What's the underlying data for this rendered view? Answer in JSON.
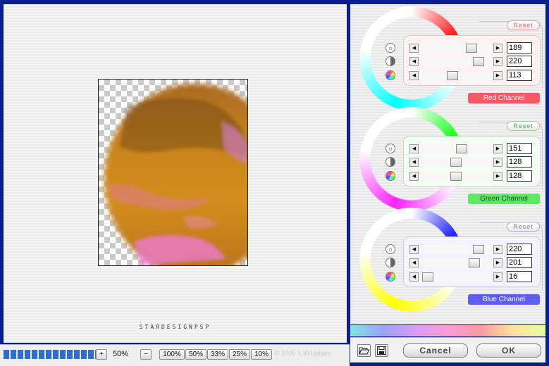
{
  "preview": {
    "credit": "STARDESIGNPSP"
  },
  "toolbar": {
    "progress_segments": 14,
    "plus_label": "+",
    "zoom_value": "50%",
    "minus_label": "−",
    "presets": [
      "100%",
      "50%",
      "33%",
      "25%",
      "10%"
    ],
    "copyright": "© 2005  S.W.Upham"
  },
  "channels": [
    {
      "name": "Red Channel",
      "reset_label": "Reset",
      "accent": "#f25a66",
      "label_text_color": "#ffffff",
      "reset_text_color": "#c86a6a",
      "reset_border": "#e0a0a0",
      "box_tint": "#fff2f2",
      "ring_colors": [
        "#ff2020",
        "#00ffff"
      ],
      "sliders": [
        {
          "icon": "sun-icon",
          "value": "189",
          "fraction": 0.74
        },
        {
          "icon": "contrast-icon",
          "value": "220",
          "fraction": 0.86
        },
        {
          "icon": "hue-icon",
          "value": "113",
          "fraction": 0.44
        }
      ]
    },
    {
      "name": "Green Channel",
      "reset_label": "Reset",
      "accent": "#56ec5e",
      "label_text_color": "#1e4a1e",
      "reset_text_color": "#5a9a5a",
      "reset_border": "#9ad49a",
      "box_tint": "#f2fff2",
      "ring_colors": [
        "#22ff22",
        "#ff22ff"
      ],
      "sliders": [
        {
          "icon": "sun-icon",
          "value": "151",
          "fraction": 0.59
        },
        {
          "icon": "contrast-icon",
          "value": "128",
          "fraction": 0.5
        },
        {
          "icon": "hue-icon",
          "value": "128",
          "fraction": 0.5
        }
      ]
    },
    {
      "name": "Blue Channel",
      "reset_label": "Reset",
      "accent": "#5d5df0",
      "label_text_color": "#ffffff",
      "reset_text_color": "#7a7ab0",
      "reset_border": "#a8a8d8",
      "box_tint": "#f4f4ff",
      "ring_colors": [
        "#2222ff",
        "#ffff00"
      ],
      "sliders": [
        {
          "icon": "sun-icon",
          "value": "220",
          "fraction": 0.86
        },
        {
          "icon": "contrast-icon",
          "value": "201",
          "fraction": 0.79
        },
        {
          "icon": "hue-icon",
          "value": "16",
          "fraction": 0.06
        }
      ]
    }
  ],
  "footer": {
    "open_icon": "folder-open-icon",
    "save_icon": "floppy-disk-icon",
    "cancel_label": "Cancel",
    "ok_label": "OK"
  }
}
